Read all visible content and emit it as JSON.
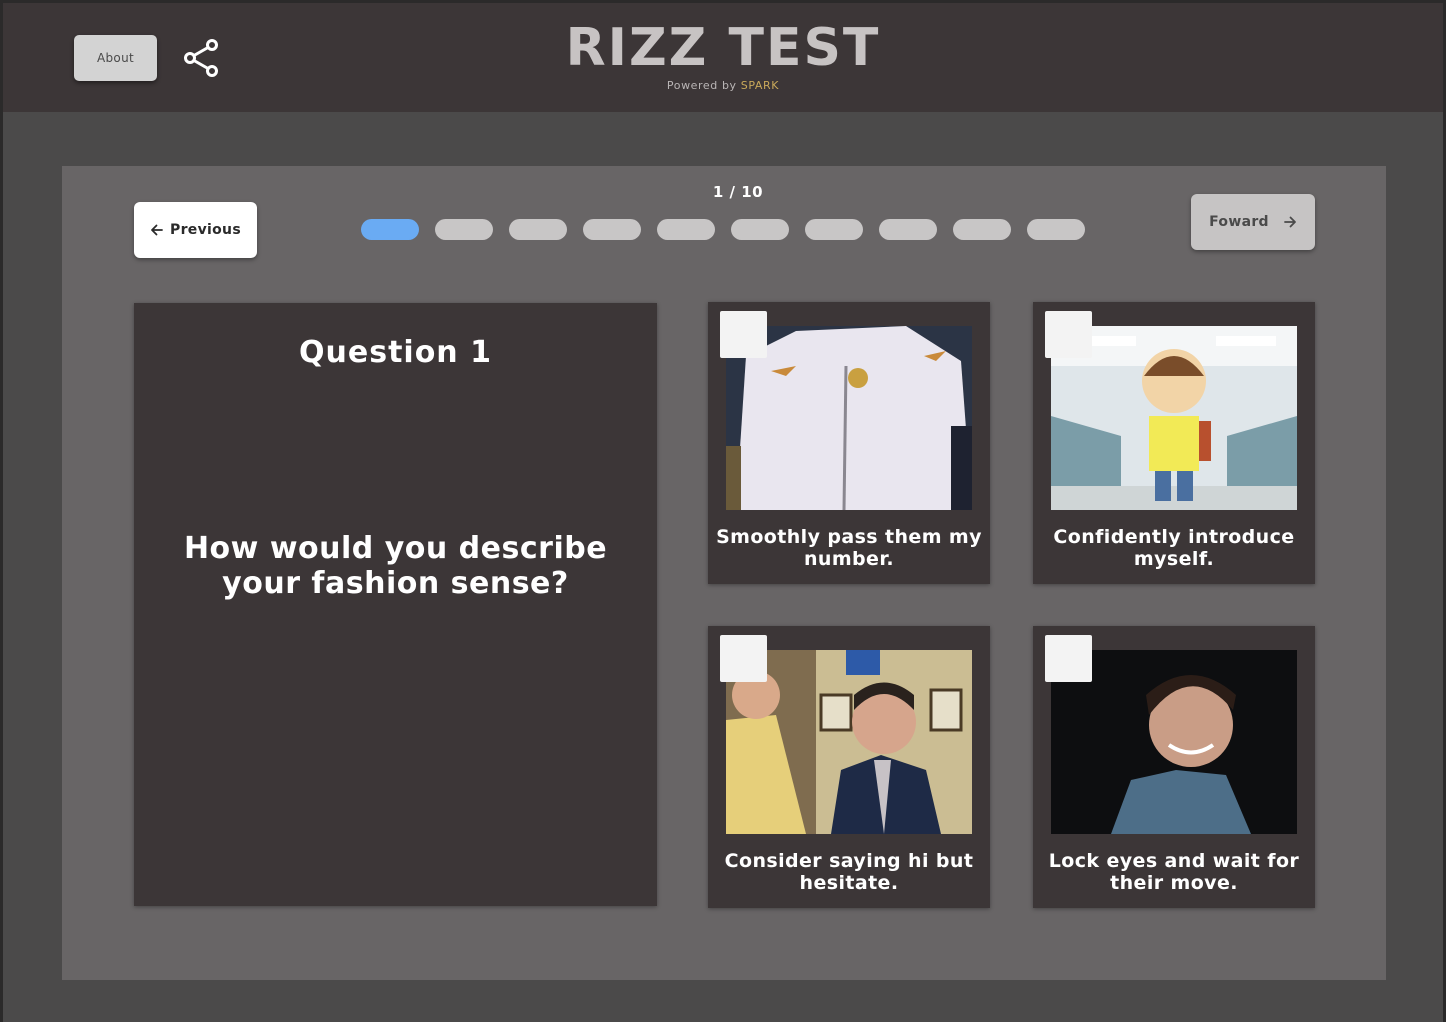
{
  "header": {
    "about_label": "About",
    "share_icon": "share-icon",
    "title": "RIZZ TEST",
    "powered_by": "Powered by",
    "powered_brand": "SPARK",
    "accent_color": "#c9a95a"
  },
  "nav": {
    "previous_label": "Previous",
    "forward_label": "Foward",
    "counter": "1 / 10",
    "current_step": 1,
    "total_steps": 10,
    "active_color": "#6aabf3"
  },
  "question": {
    "title": "Question 1",
    "text": "How would you describe your fashion sense?"
  },
  "options": [
    {
      "label": "Smoothly pass them my number.",
      "image": "man in white zip jacket gif"
    },
    {
      "label": "Confidently introduce myself.",
      "image": "cartoon character in school hallway gif"
    },
    {
      "label": "Consider saying hi but hesitate.",
      "image": "office scene grimacing man gif"
    },
    {
      "label": "Lock eyes and wait for their move.",
      "image": "smiling man dark background gif"
    }
  ]
}
